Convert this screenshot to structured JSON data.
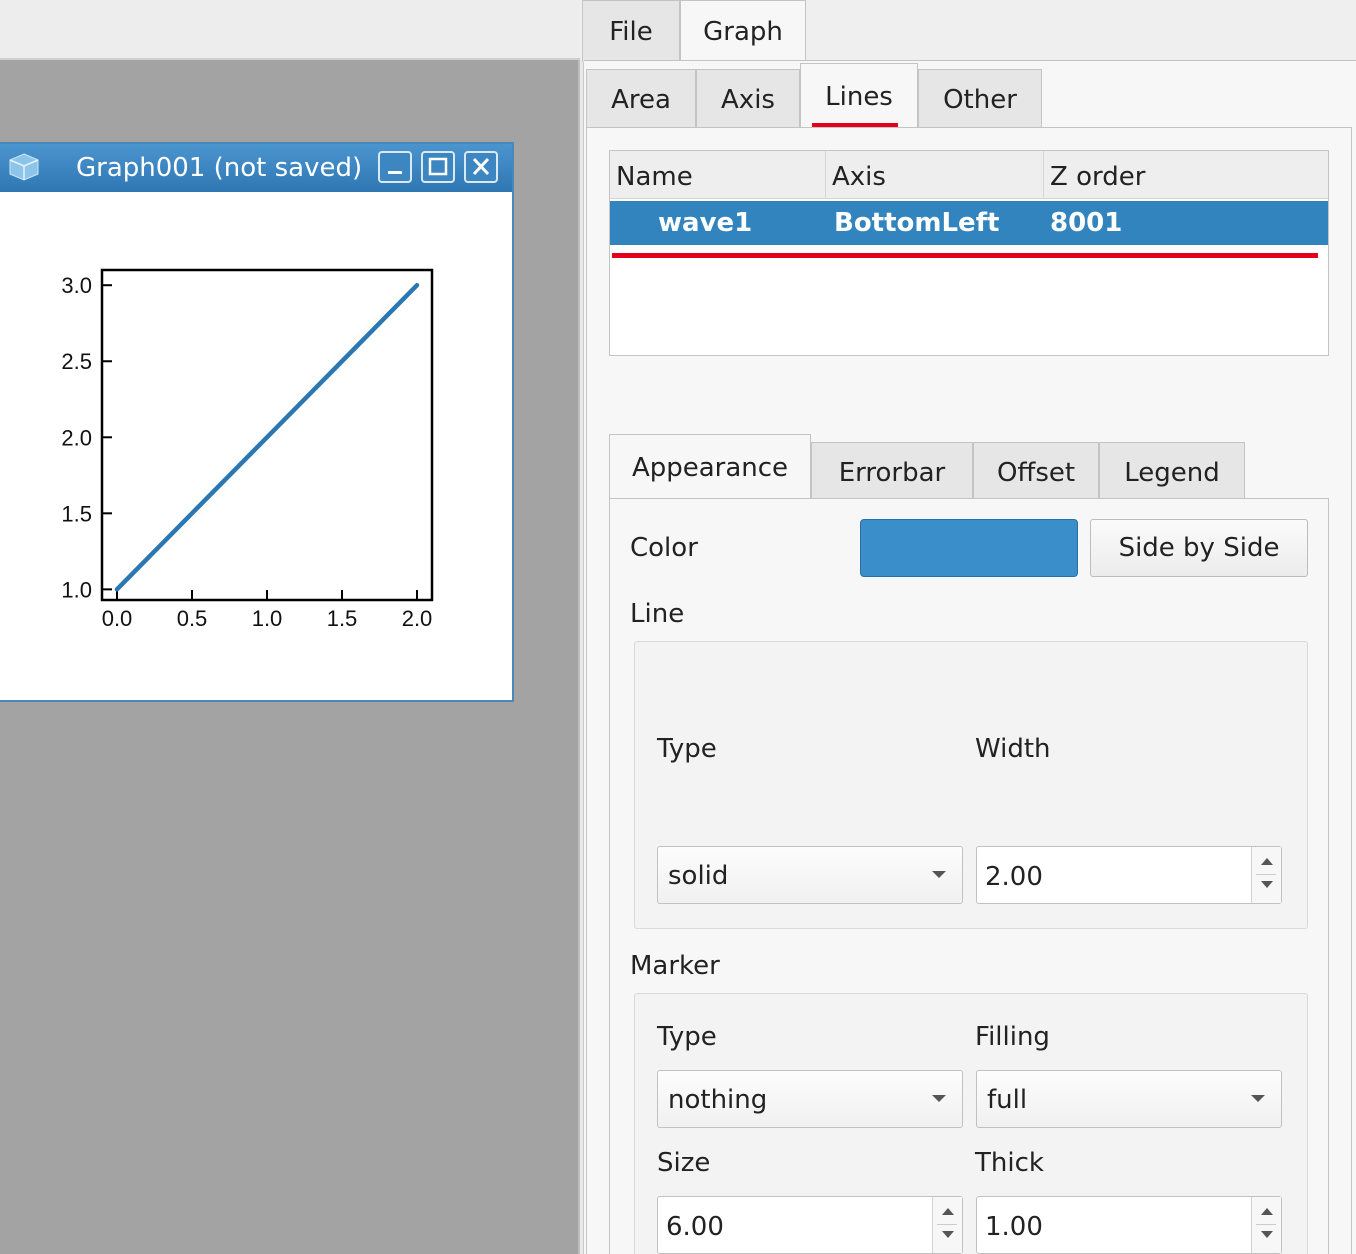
{
  "graph_window": {
    "title": "Graph001 (not saved)"
  },
  "chart_data": {
    "type": "line",
    "title": "",
    "xlabel": "",
    "ylabel": "",
    "x": [
      0.0,
      0.5,
      1.0,
      1.5,
      2.0
    ],
    "series": [
      {
        "values": [
          1.0,
          1.5,
          2.0,
          2.5,
          3.0
        ],
        "color": "#2a77b1"
      }
    ],
    "xlim": [
      -0.1,
      2.1
    ],
    "ylim": [
      0.93,
      3.1
    ],
    "xticks": [
      "0.0",
      "0.5",
      "1.0",
      "1.5",
      "2.0"
    ],
    "yticks": [
      "1.0",
      "1.5",
      "2.0",
      "2.5",
      "3.0"
    ],
    "grid": false
  },
  "top_tabs": {
    "file": "File",
    "graph": "Graph"
  },
  "graph_tabs": {
    "area": "Area",
    "axis": "Axis",
    "lines": "Lines",
    "other": "Other"
  },
  "lines_table": {
    "headers": {
      "name": "Name",
      "axis": "Axis",
      "z_order": "Z order"
    },
    "rows": [
      {
        "name": "wave1",
        "axis": "BottomLeft",
        "z_order": "8001"
      }
    ]
  },
  "line_tabs": {
    "appearance": "Appearance",
    "errorbar": "Errorbar",
    "offset": "Offset",
    "legend": "Legend"
  },
  "appearance": {
    "color_label": "Color",
    "color_value": "#3a8fcb",
    "side_by_side": "Side by Side",
    "line_title": "Line",
    "line_type_label": "Type",
    "line_width_label": "Width",
    "line_type_value": "solid",
    "line_width_value": "2.00",
    "marker_title": "Marker",
    "marker_type_label": "Type",
    "marker_filling_label": "Filling",
    "marker_type_value": "nothing",
    "marker_filling_value": "full",
    "marker_size_label": "Size",
    "marker_thick_label": "Thick",
    "marker_size_value": "6.00",
    "marker_thick_value": "1.00"
  },
  "colors": {
    "selection": "#3184bd",
    "highlight_red": "#e3001b",
    "titlebar": "#3a86c3"
  }
}
